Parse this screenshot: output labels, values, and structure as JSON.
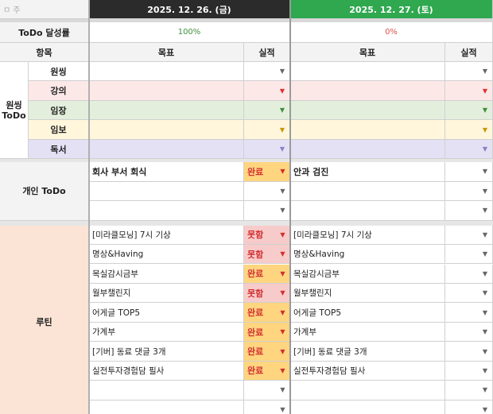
{
  "colors": {
    "header_dark": "#2b2b2b",
    "header_green": "#2fa84f",
    "row_red": "#fde8e8",
    "row_green": "#e3efdc",
    "row_yellow": "#fff6dc",
    "row_purple": "#e4e1f5",
    "routine_bg": "#fbe4d5",
    "status_done": "#ffd580",
    "status_fail": "#f8cbcb"
  },
  "header": {
    "week_label": "ㅁ 주",
    "date1": "2025. 12. 26. (금)",
    "date2": "2025. 12. 27. (토)"
  },
  "achievement": {
    "label": "ToDo 달성률",
    "day1": "100%",
    "day2": "0%"
  },
  "columns": {
    "item": "항목",
    "goal": "목표",
    "result": "실적"
  },
  "onesing": {
    "group_label": "원씽\nToDo",
    "rows": [
      {
        "label": "원씽"
      },
      {
        "label": "강의"
      },
      {
        "label": "임장"
      },
      {
        "label": "임보"
      },
      {
        "label": "독서"
      }
    ]
  },
  "personal": {
    "group_label": "개인 ToDo",
    "rows": [
      {
        "goal1": "회사 부서 회식",
        "status1": "완료",
        "goal2": "안과 검진",
        "status2": ""
      },
      {
        "goal1": "",
        "status1": "",
        "goal2": "",
        "status2": ""
      },
      {
        "goal1": "",
        "status1": "",
        "goal2": "",
        "status2": ""
      }
    ]
  },
  "routine": {
    "group_label": "루틴",
    "rows": [
      {
        "goal1": "[미라클모닝] 7시 기상",
        "status1": "못함",
        "goal2": "[미라클모닝] 7시 기상",
        "status2": ""
      },
      {
        "goal1": "명상&Having",
        "status1": "못함",
        "goal2": "명상&Having",
        "status2": ""
      },
      {
        "goal1": "목실감시금부",
        "status1": "완료",
        "goal2": "목실감시금부",
        "status2": ""
      },
      {
        "goal1": "월부챌린지",
        "status1": "못함",
        "goal2": "월부챌린지",
        "status2": ""
      },
      {
        "goal1": "어게글 TOP5",
        "status1": "완료",
        "goal2": "어게글 TOP5",
        "status2": ""
      },
      {
        "goal1": "가계부",
        "status1": "완료",
        "goal2": "가계부",
        "status2": ""
      },
      {
        "goal1": "[기버] 동료 댓글 3개",
        "status1": "완료",
        "goal2": "[기버] 동료 댓글 3개",
        "status2": ""
      },
      {
        "goal1": "실전투자경험담 필사",
        "status1": "완료",
        "goal2": "실전투자경험담 필사",
        "status2": ""
      },
      {
        "goal1": "",
        "status1": "",
        "goal2": "",
        "status2": ""
      },
      {
        "goal1": "",
        "status1": "",
        "goal2": "",
        "status2": ""
      }
    ]
  },
  "icons": {
    "dropdown": "▼"
  }
}
